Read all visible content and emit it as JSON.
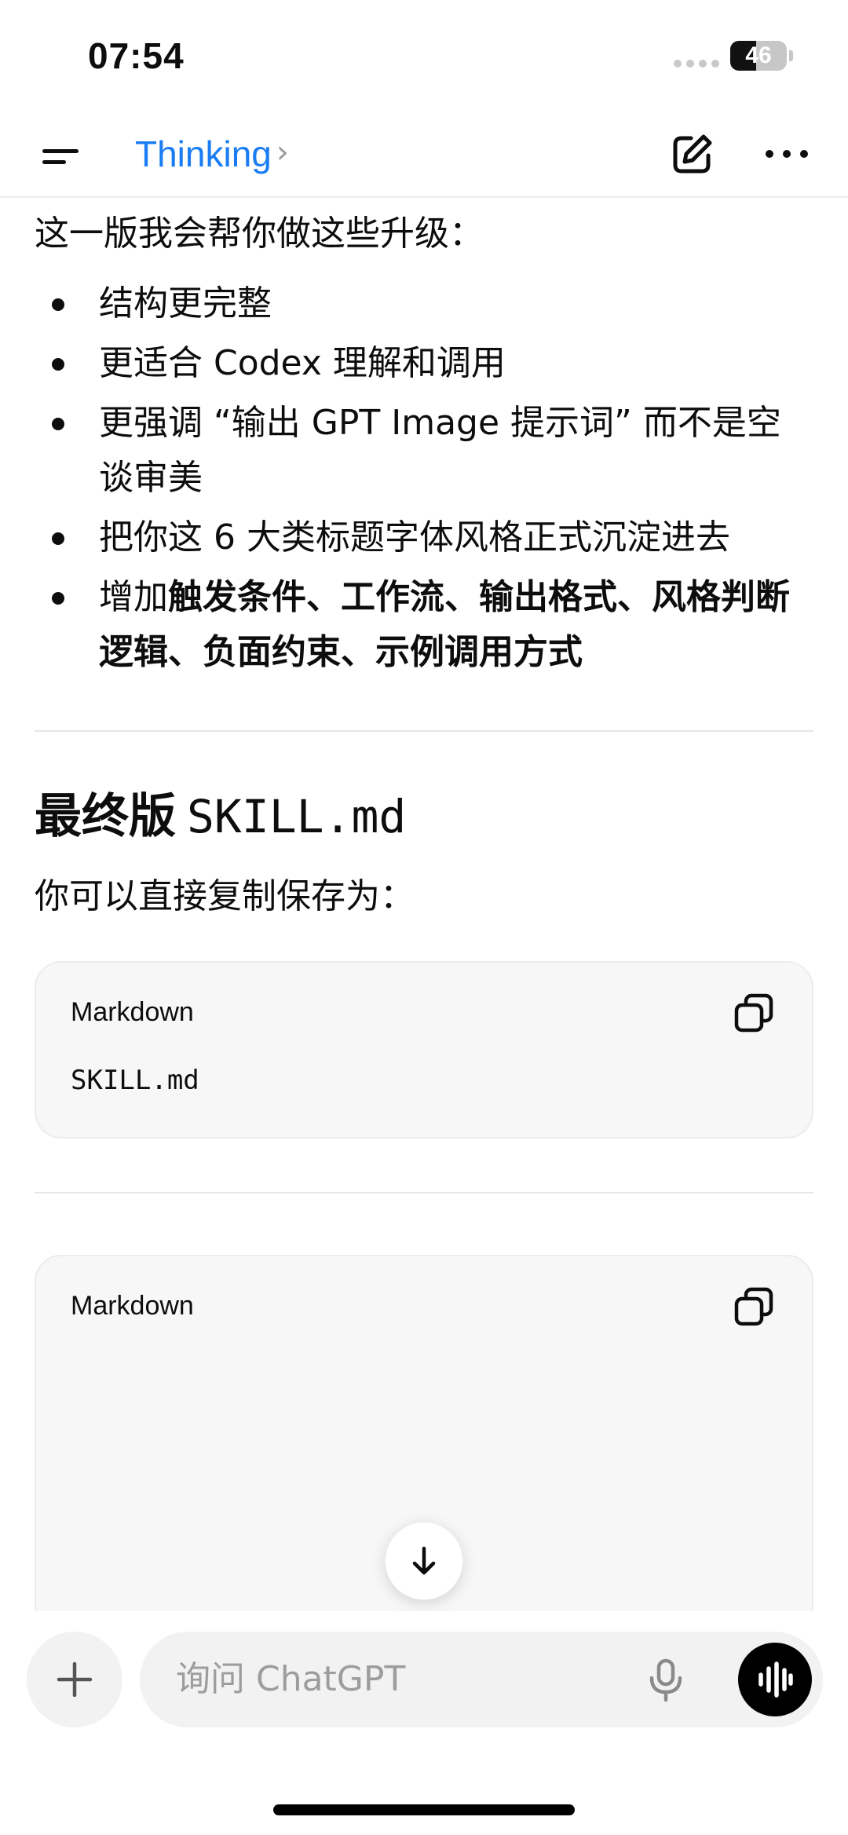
{
  "status_bar": {
    "time": "07:54",
    "battery_level": "46",
    "battery_fraction": 0.46
  },
  "header": {
    "model_label": "Thinking",
    "chevron": "›",
    "menu_icon": "menu-icon",
    "edit_icon": "new-chat-icon",
    "more_icon": "more-icon"
  },
  "message": {
    "intro": "这一版我会帮你做这些升级：",
    "bullets": [
      {
        "plain": "结构更完整",
        "bold": ""
      },
      {
        "plain": "更适合 Codex 理解和调用",
        "bold": ""
      },
      {
        "plain": "更强调 “输出 GPT Image 提示词” 而不是空谈审美",
        "bold": ""
      },
      {
        "plain": "把你这 6 大类标题字体风格正式沉淀进去",
        "bold": ""
      },
      {
        "plain": "增加",
        "bold": "触发条件、工作流、输出格式、风格判断逻辑、负面约束、示例调用方式"
      }
    ],
    "heading_text": "最终版",
    "heading_code": "SKILL.md",
    "subtitle": "你可以直接复制保存为：",
    "code_blocks": [
      {
        "language": "Markdown",
        "code": "SKILL.md"
      },
      {
        "language": "Markdown",
        "code": ""
      }
    ]
  },
  "composer": {
    "placeholder": "询问 ChatGPT",
    "add_icon": "plus-icon",
    "mic_icon": "microphone-icon",
    "voice_icon": "voice-mode-icon"
  },
  "colors": {
    "accent": "#1a7df3",
    "card_bg": "#f7f7f7",
    "pill_bg": "#f2f2f2"
  }
}
